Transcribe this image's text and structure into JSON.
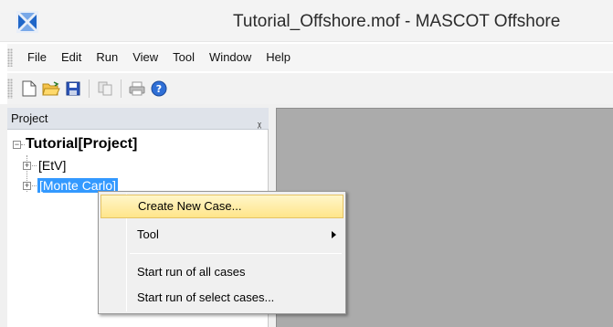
{
  "window": {
    "title": "Tutorial_Offshore.mof - MASCOT Offshore",
    "app_icon": "mascot-app-icon"
  },
  "menubar": {
    "items": [
      "File",
      "Edit",
      "Run",
      "View",
      "Tool",
      "Window",
      "Help"
    ]
  },
  "toolbar": {
    "buttons": [
      "new-file-icon",
      "open-folder-icon",
      "save-icon",
      "copy-icon",
      "print-icon",
      "help-icon"
    ]
  },
  "project_pane": {
    "title": "Project",
    "pin_icon": "pin-icon",
    "tree": {
      "root": "Tutorial[Project]",
      "children": [
        "[EtV]",
        "[Monte Carlo]"
      ],
      "selected": "[Monte Carlo]"
    }
  },
  "context_menu": {
    "items": [
      {
        "label": "Create New Case...",
        "highlighted": true
      },
      {
        "label": "Tool",
        "submenu": true
      },
      {
        "label": "Start run of all cases"
      },
      {
        "label": "Start run of select cases..."
      }
    ]
  },
  "colors": {
    "selection": "#3399ff",
    "workspace": "#ababab",
    "menu_highlight": "#ffe58a"
  }
}
